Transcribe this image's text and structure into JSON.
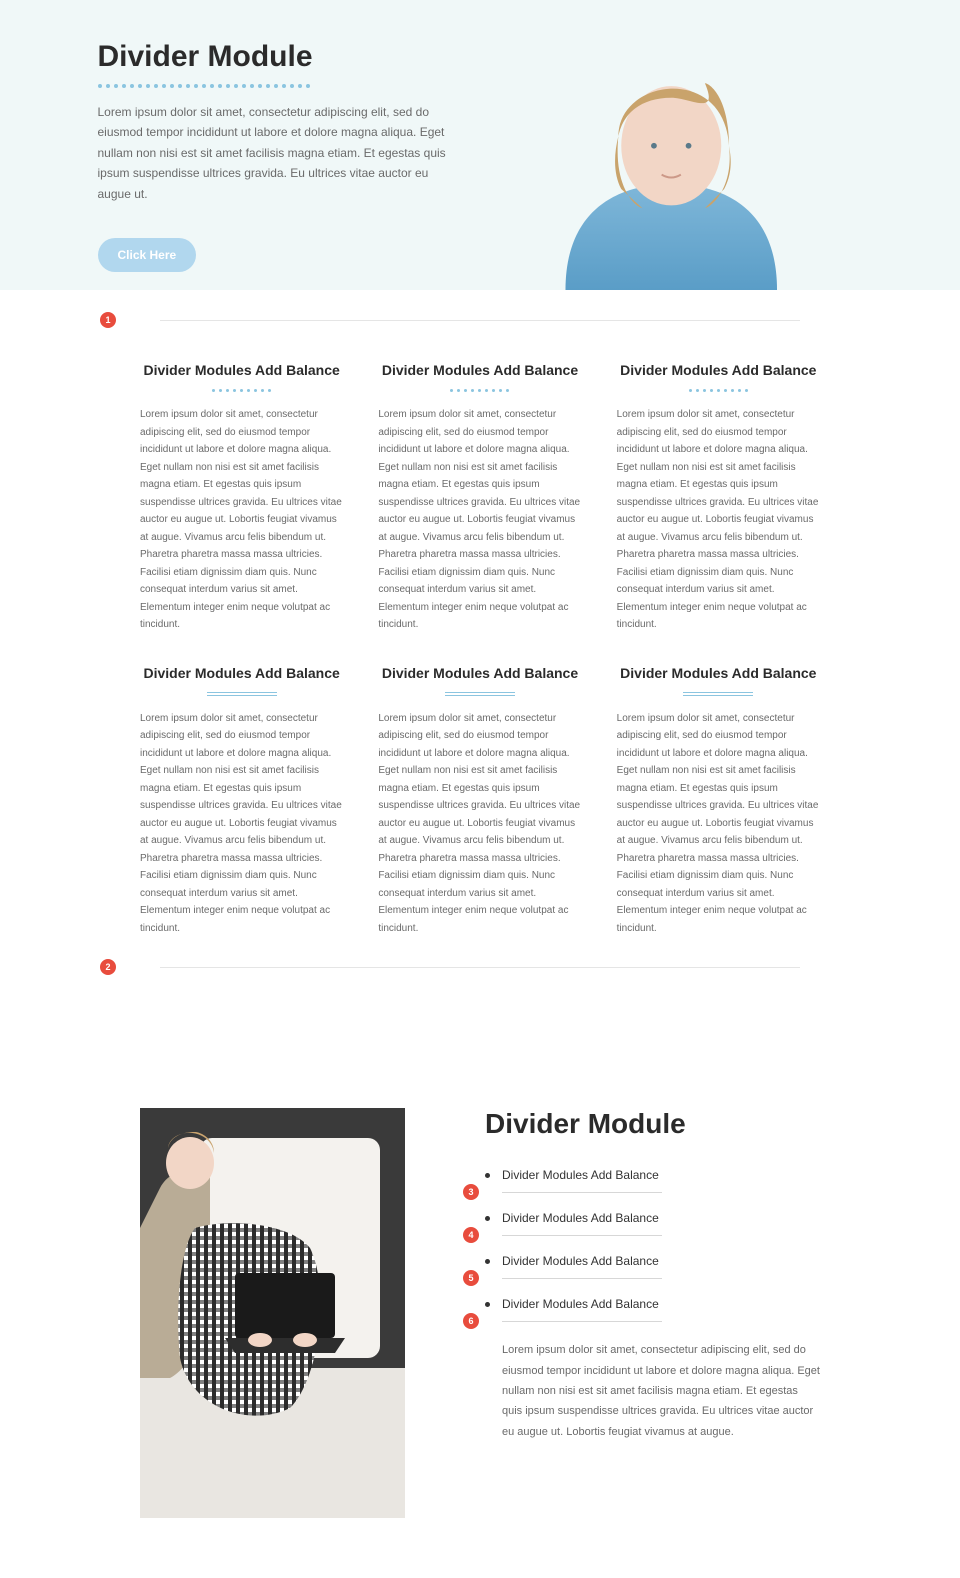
{
  "hero": {
    "title": "Divider Module",
    "text": "Lorem ipsum dolor sit amet, consectetur adipiscing elit, sed do eiusmod tempor incididunt ut labore et dolore magna aliqua. Eget nullam non nisi est sit amet facilisis magna etiam. Et egestas quis ipsum suspendisse ultrices gravida. Eu ultrices vitae auctor eu augue ut.",
    "button": "Click Here"
  },
  "badges": {
    "b1": "1",
    "b2": "2",
    "b3": "3",
    "b4": "4",
    "b5": "5",
    "b6": "6"
  },
  "card_title": "Divider Modules Add Balance",
  "card_text": "Lorem ipsum dolor sit amet, consectetur adipiscing elit, sed do eiusmod tempor incididunt ut labore et dolore magna aliqua. Eget nullam non nisi est sit amet facilisis magna etiam. Et egestas quis ipsum suspendisse ultrices gravida. Eu ultrices vitae auctor eu augue ut. Lobortis feugiat vivamus at augue. Vivamus arcu felis bibendum ut. Pharetra pharetra massa massa ultricies. Facilisi etiam dignissim diam quis. Nunc consequat interdum varius sit amet. Elementum integer enim neque volutpat ac tincidunt.",
  "bottom": {
    "title": "Divider Module",
    "item": "Divider Modules Add Balance",
    "para": "Lorem ipsum dolor sit amet, consectetur adipiscing elit, sed do eiusmod tempor incididunt ut labore et dolore magna aliqua. Eget nullam non nisi est sit amet facilisis magna etiam. Et egestas quis ipsum suspendisse ultrices gravida. Eu ultrices vitae auctor eu augue ut. Lobortis feugiat vivamus at augue."
  }
}
